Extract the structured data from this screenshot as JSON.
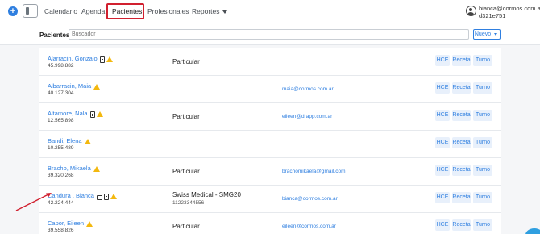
{
  "navbar": {
    "add_label": "+",
    "links": [
      "Calendario",
      "Agenda",
      "Pacientes",
      "Profesionales",
      "Reportes"
    ],
    "active": "Pacientes",
    "user_email": "bianca@cormos.com.ar",
    "user_code": "d321e751"
  },
  "search": {
    "label": "Pacientes",
    "placeholder": "Buscador",
    "new_button": "Nuevo"
  },
  "actions": {
    "hce": "HCE",
    "receta": "Receta",
    "turno": "Turno"
  },
  "patients": [
    {
      "name": "Alarracin, Gonzalo",
      "doc": "45.998.882",
      "icons": [
        "doc-icon",
        "warning-icon"
      ],
      "coverage": "Particular",
      "coverage_number": "",
      "email": ""
    },
    {
      "name": "Albarracin, Maia",
      "doc": "40.127.304",
      "icons": [
        "warning-icon"
      ],
      "coverage": "",
      "coverage_number": "",
      "email": "maia@cormos.com.ar"
    },
    {
      "name": "Altamore, Nala",
      "doc": "12.565.898",
      "icons": [
        "doc-icon",
        "warning-icon"
      ],
      "coverage": "Particular",
      "coverage_number": "",
      "email": "eileen@drapp.com.ar"
    },
    {
      "name": "Bandi, Elena",
      "doc": "10.255.489",
      "icons": [
        "warning-icon"
      ],
      "coverage": "",
      "coverage_number": "",
      "email": ""
    },
    {
      "name": "Bracho, Mikaela",
      "doc": "39.320.268",
      "icons": [
        "warning-icon"
      ],
      "coverage": "Particular",
      "coverage_number": "",
      "email": "brachomikaela@gmail.com"
    },
    {
      "name": "Candura , Bianca",
      "doc": "42.224.444",
      "icons": [
        "briefcase-icon",
        "doc-icon",
        "warning-icon"
      ],
      "coverage": "Swiss Medical - SMG20",
      "coverage_number": "11223344556",
      "email": "bianca@cormos.com.ar"
    },
    {
      "name": "Capor, Eileen",
      "doc": "39.558.826",
      "icons": [
        "warning-icon"
      ],
      "coverage": "Particular",
      "coverage_number": "",
      "email": "eileen@cormos.com.ar"
    }
  ],
  "colors": {
    "accent": "#2f7fe0",
    "highlight": "#d1202f",
    "warning": "#f3b80f"
  }
}
